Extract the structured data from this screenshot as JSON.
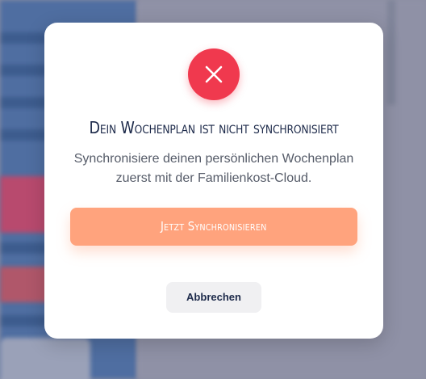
{
  "dialog": {
    "icon": "close-x-icon",
    "title": "Dein Wochenplan ist nicht synchronisiert",
    "message_line1": "Synchronisiere deinen persönlichen Wochenplan",
    "message_line2": "zuerst mit der Familienkost-Cloud.",
    "primary_label": "Jetzt Synchronisieren",
    "cancel_label": "Abbrechen"
  },
  "colors": {
    "error": "#f0394e",
    "primary": "#ffa37d",
    "title_text": "#1d2a4a",
    "cancel_bg": "#f0f0f2"
  }
}
